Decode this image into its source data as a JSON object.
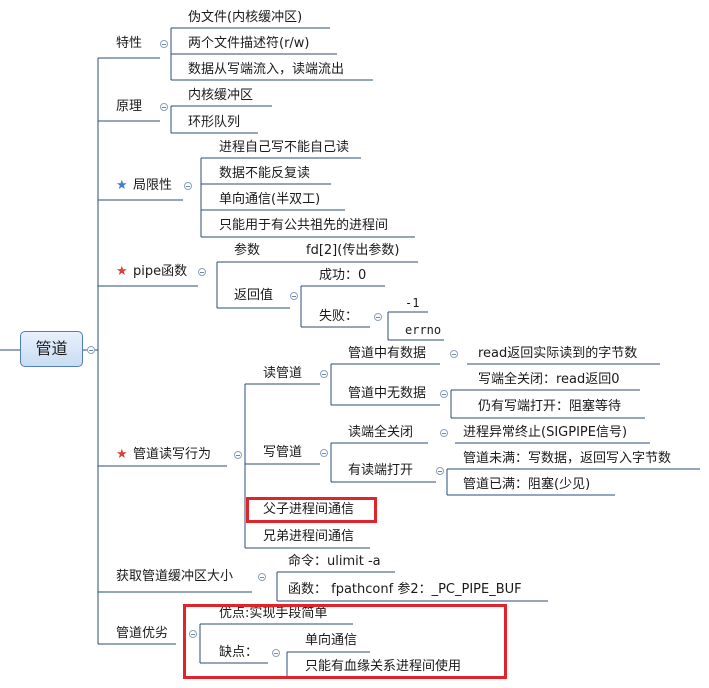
{
  "root": "管道",
  "branches": {
    "features": {
      "label": "特性",
      "items": [
        "伪文件(内核缓冲区)",
        "两个文件描述符(r/w)",
        "数据从写端流入，读端流出"
      ]
    },
    "principle": {
      "label": "原理",
      "items": [
        "内核缓冲区",
        "环形队列"
      ]
    },
    "limits": {
      "label": "局限性",
      "items": [
        "进程自己写不能自己读",
        "数据不能反复读",
        "单向通信(半双工)",
        "只能用于有公共祖先的进程间"
      ]
    },
    "pipe_func": {
      "label": "pipe函数",
      "param_label": "参数",
      "param_value": "fd[2](传出参数)",
      "ret_label": "返回值",
      "success": "成功：0",
      "fail": "失败：",
      "fail_values": [
        "-1",
        "errno"
      ]
    },
    "rw": {
      "label": "管道读写行为",
      "read": {
        "label": "读管道",
        "has_data": "管道中有数据",
        "has_data_result": "read返回实际读到的字节数",
        "no_data": "管道中无数据",
        "no_data_results": [
          "写端全关闭：read返回0",
          "仍有写端打开：阻塞等待"
        ]
      },
      "write": {
        "label": "写管道",
        "read_closed": "读端全关闭",
        "read_closed_result": "进程异常终止(SIGPIPE信号)",
        "read_open": "有读端打开",
        "read_open_results": [
          "管道未满：写数据，返回写入字节数",
          "管道已满：阻塞(少见)"
        ]
      },
      "parent_child": "父子进程间通信",
      "siblings": "兄弟进程间通信"
    },
    "bufsize": {
      "label": "获取管道缓冲区大小",
      "command": "命令：ulimit -a",
      "function": "函数：  fpathconf 参2：_PC_PIPE_BUF"
    },
    "proscons": {
      "label": "管道优劣",
      "pros": "优点:实现手段简单",
      "cons_label": "缺点：",
      "cons": [
        "单向通信",
        "只能有血缘关系进程间使用"
      ]
    }
  },
  "colors": {
    "line": "#2b4b78",
    "star_blue": "#3a7fd5",
    "star_red": "#d94040",
    "highlight": "#e0252a"
  }
}
